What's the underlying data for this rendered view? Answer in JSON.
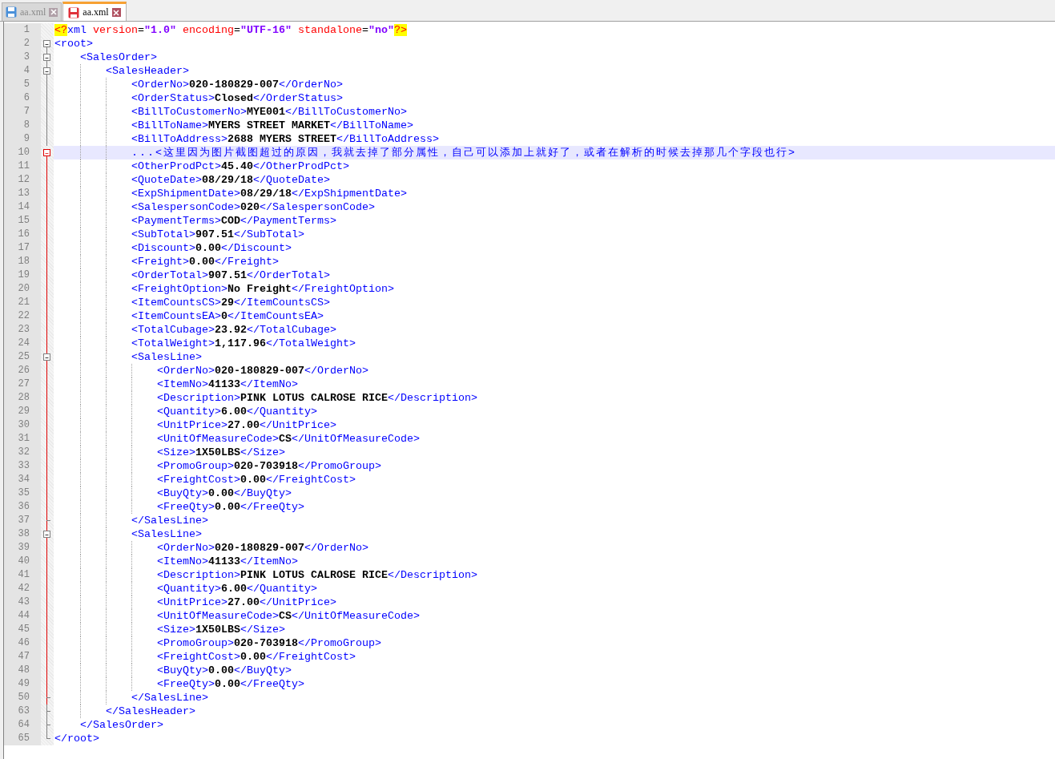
{
  "tabs": [
    {
      "label": "aa.xml",
      "selected": false,
      "modified": false
    },
    {
      "label": "aa.xml",
      "selected": true,
      "modified": true
    }
  ],
  "lines": [
    {
      "number": "1",
      "kind": "blank",
      "tokens": [
        {
          "kind": "pi",
          "text": "<?"
        },
        {
          "kind": "name",
          "text": "xml "
        },
        {
          "kind": "attr",
          "text": "version"
        },
        {
          "kind": "eq",
          "text": "="
        },
        {
          "kind": "value",
          "text": "\"1.0\""
        },
        {
          "kind": "attr",
          "text": " encoding"
        },
        {
          "kind": "eq",
          "text": "="
        },
        {
          "kind": "value",
          "text": "\"UTF-16\""
        },
        {
          "kind": "attr",
          "text": " standalone"
        },
        {
          "kind": "eq",
          "text": "="
        },
        {
          "kind": "value",
          "text": "\"no\""
        },
        {
          "kind": "pi",
          "text": "?>"
        }
      ]
    },
    {
      "number": "2",
      "kind": "root",
      "tokens": [
        {
          "kind": "tag",
          "text": "<root>"
        }
      ],
      "children": [
        {
          "number": "3",
          "kind": "open",
          "tokens": [
            {
              "kind": "tag",
              "text": "<SalesOrder>"
            }
          ],
          "children": [
            {
              "number": "4",
              "kind": "open",
              "tokens": [
                {
                  "kind": "tag",
                  "text": "<SalesHeader>"
                }
              ],
              "children": [
                {
                  "number": "5",
                  "kind": "line",
                  "tokens": [
                    {
                      "kind": "tag",
                      "text": "<OrderNo>"
                    },
                    {
                      "kind": "text",
                      "text": "020-180829-007"
                    },
                    {
                      "kind": "tag",
                      "text": "</OrderNo>"
                    }
                  ]
                },
                {
                  "number": "6",
                  "kind": "line",
                  "tokens": [
                    {
                      "kind": "tag",
                      "text": "<OrderStatus>"
                    },
                    {
                      "kind": "text",
                      "text": "Closed"
                    },
                    {
                      "kind": "tag",
                      "text": "</OrderStatus>"
                    }
                  ]
                },
                {
                  "number": "7",
                  "kind": "line",
                  "tokens": [
                    {
                      "kind": "tag",
                      "text": "<BillToCustomerNo>"
                    },
                    {
                      "kind": "text",
                      "text": "MYE001"
                    },
                    {
                      "kind": "tag",
                      "text": "</BillToCustomerNo>"
                    }
                  ]
                },
                {
                  "number": "8",
                  "kind": "line",
                  "tokens": [
                    {
                      "kind": "tag",
                      "text": "<BillToName>"
                    },
                    {
                      "kind": "text",
                      "text": "MYERS STREET MARKET"
                    },
                    {
                      "kind": "tag",
                      "text": "</BillToName>"
                    }
                  ]
                },
                {
                  "number": "9",
                  "kind": "line",
                  "tokens": [
                    {
                      "kind": "tag",
                      "text": "<BillToAddress>"
                    },
                    {
                      "kind": "text",
                      "text": "2688 MYERS STREET"
                    },
                    {
                      "kind": "tag",
                      "text": "</BillToAddress>"
                    }
                  ]
                },
                {
                  "number": "10",
                  "kind": "folded",
                  "current": true,
                  "red": true,
                  "tokens": [
                    {
                      "kind": "note",
                      "text": "...<这里因为图片截图超过的原因，我就去掉了部分属性，自己可以添加上就好了，或者在解析的时候去掉那几个字段也行>"
                    }
                  ]
                },
                {
                  "number": "11",
                  "kind": "line",
                  "red": true,
                  "tokens": [
                    {
                      "kind": "tag",
                      "text": "<OtherProdPct>"
                    },
                    {
                      "kind": "text",
                      "text": "45.40"
                    },
                    {
                      "kind": "tag",
                      "text": "</OtherProdPct>"
                    }
                  ]
                },
                {
                  "number": "12",
                  "kind": "line",
                  "red": true,
                  "tokens": [
                    {
                      "kind": "tag",
                      "text": "<QuoteDate>"
                    },
                    {
                      "kind": "text",
                      "text": "08/29/18"
                    },
                    {
                      "kind": "tag",
                      "text": "</QuoteDate>"
                    }
                  ]
                },
                {
                  "number": "13",
                  "kind": "line",
                  "red": true,
                  "tokens": [
                    {
                      "kind": "tag",
                      "text": "<ExpShipmentDate>"
                    },
                    {
                      "kind": "text",
                      "text": "08/29/18"
                    },
                    {
                      "kind": "tag",
                      "text": "</ExpShipmentDate>"
                    }
                  ]
                },
                {
                  "number": "14",
                  "kind": "line",
                  "red": true,
                  "tokens": [
                    {
                      "kind": "tag",
                      "text": "<SalespersonCode>"
                    },
                    {
                      "kind": "text",
                      "text": "020"
                    },
                    {
                      "kind": "tag",
                      "text": "</SalespersonCode>"
                    }
                  ]
                },
                {
                  "number": "15",
                  "kind": "line",
                  "red": true,
                  "tokens": [
                    {
                      "kind": "tag",
                      "text": "<PaymentTerms>"
                    },
                    {
                      "kind": "text",
                      "text": "COD"
                    },
                    {
                      "kind": "tag",
                      "text": "</PaymentTerms>"
                    }
                  ]
                },
                {
                  "number": "16",
                  "kind": "line",
                  "red": true,
                  "tokens": [
                    {
                      "kind": "tag",
                      "text": "<SubTotal>"
                    },
                    {
                      "kind": "text",
                      "text": "907.51"
                    },
                    {
                      "kind": "tag",
                      "text": "</SubTotal>"
                    }
                  ]
                },
                {
                  "number": "17",
                  "kind": "line",
                  "red": true,
                  "tokens": [
                    {
                      "kind": "tag",
                      "text": "<Discount>"
                    },
                    {
                      "kind": "text",
                      "text": "0.00"
                    },
                    {
                      "kind": "tag",
                      "text": "</Discount>"
                    }
                  ]
                },
                {
                  "number": "18",
                  "kind": "line",
                  "red": true,
                  "tokens": [
                    {
                      "kind": "tag",
                      "text": "<Freight>"
                    },
                    {
                      "kind": "text",
                      "text": "0.00"
                    },
                    {
                      "kind": "tag",
                      "text": "</Freight>"
                    }
                  ]
                },
                {
                  "number": "19",
                  "kind": "line",
                  "red": true,
                  "tokens": [
                    {
                      "kind": "tag",
                      "text": "<OrderTotal>"
                    },
                    {
                      "kind": "text",
                      "text": "907.51"
                    },
                    {
                      "kind": "tag",
                      "text": "</OrderTotal>"
                    }
                  ]
                },
                {
                  "number": "20",
                  "kind": "line",
                  "red": true,
                  "tokens": [
                    {
                      "kind": "tag",
                      "text": "<FreightOption>"
                    },
                    {
                      "kind": "text",
                      "text": "No Freight"
                    },
                    {
                      "kind": "tag",
                      "text": "</FreightOption>"
                    }
                  ]
                },
                {
                  "number": "21",
                  "kind": "line",
                  "red": true,
                  "tokens": [
                    {
                      "kind": "tag",
                      "text": "<ItemCountsCS>"
                    },
                    {
                      "kind": "text",
                      "text": "29"
                    },
                    {
                      "kind": "tag",
                      "text": "</ItemCountsCS>"
                    }
                  ]
                },
                {
                  "number": "22",
                  "kind": "line",
                  "red": true,
                  "tokens": [
                    {
                      "kind": "tag",
                      "text": "<ItemCountsEA>"
                    },
                    {
                      "kind": "text",
                      "text": "0"
                    },
                    {
                      "kind": "tag",
                      "text": "</ItemCountsEA>"
                    }
                  ]
                },
                {
                  "number": "23",
                  "kind": "line",
                  "red": true,
                  "tokens": [
                    {
                      "kind": "tag",
                      "text": "<TotalCubage>"
                    },
                    {
                      "kind": "text",
                      "text": "23.92"
                    },
                    {
                      "kind": "tag",
                      "text": "</TotalCubage>"
                    }
                  ]
                },
                {
                  "number": "24",
                  "kind": "line",
                  "red": true,
                  "tokens": [
                    {
                      "kind": "tag",
                      "text": "<TotalWeight>"
                    },
                    {
                      "kind": "text",
                      "text": "1,117.96"
                    },
                    {
                      "kind": "tag",
                      "text": "</TotalWeight>"
                    }
                  ]
                },
                {
                  "number": "25",
                  "kind": "open",
                  "red": true,
                  "tokens": [
                    {
                      "kind": "tag",
                      "text": "<SalesLine>"
                    }
                  ],
                  "children": [
                    {
                      "number": "26",
                      "kind": "line",
                      "red": true,
                      "tokens": [
                        {
                          "kind": "tag",
                          "text": "<OrderNo>"
                        },
                        {
                          "kind": "text",
                          "text": "020-180829-007"
                        },
                        {
                          "kind": "tag",
                          "text": "</OrderNo>"
                        }
                      ]
                    },
                    {
                      "number": "27",
                      "kind": "line",
                      "red": true,
                      "tokens": [
                        {
                          "kind": "tag",
                          "text": "<ItemNo>"
                        },
                        {
                          "kind": "text",
                          "text": "41133"
                        },
                        {
                          "kind": "tag",
                          "text": "</ItemNo>"
                        }
                      ]
                    },
                    {
                      "number": "28",
                      "kind": "line",
                      "red": true,
                      "tokens": [
                        {
                          "kind": "tag",
                          "text": "<Description>"
                        },
                        {
                          "kind": "text",
                          "text": "PINK LOTUS CALROSE RICE"
                        },
                        {
                          "kind": "tag",
                          "text": "</Description>"
                        }
                      ]
                    },
                    {
                      "number": "29",
                      "kind": "line",
                      "red": true,
                      "tokens": [
                        {
                          "kind": "tag",
                          "text": "<Quantity>"
                        },
                        {
                          "kind": "text",
                          "text": "6.00"
                        },
                        {
                          "kind": "tag",
                          "text": "</Quantity>"
                        }
                      ]
                    },
                    {
                      "number": "30",
                      "kind": "line",
                      "red": true,
                      "tokens": [
                        {
                          "kind": "tag",
                          "text": "<UnitPrice>"
                        },
                        {
                          "kind": "text",
                          "text": "27.00"
                        },
                        {
                          "kind": "tag",
                          "text": "</UnitPrice>"
                        }
                      ]
                    },
                    {
                      "number": "31",
                      "kind": "line",
                      "red": true,
                      "tokens": [
                        {
                          "kind": "tag",
                          "text": "<UnitOfMeasureCode>"
                        },
                        {
                          "kind": "text",
                          "text": "CS"
                        },
                        {
                          "kind": "tag",
                          "text": "</UnitOfMeasureCode>"
                        }
                      ]
                    },
                    {
                      "number": "32",
                      "kind": "line",
                      "red": true,
                      "tokens": [
                        {
                          "kind": "tag",
                          "text": "<Size>"
                        },
                        {
                          "kind": "text",
                          "text": "1X50LBS"
                        },
                        {
                          "kind": "tag",
                          "text": "</Size>"
                        }
                      ]
                    },
                    {
                      "number": "33",
                      "kind": "line",
                      "red": true,
                      "tokens": [
                        {
                          "kind": "tag",
                          "text": "<PromoGroup>"
                        },
                        {
                          "kind": "text",
                          "text": "020-703918"
                        },
                        {
                          "kind": "tag",
                          "text": "</PromoGroup>"
                        }
                      ]
                    },
                    {
                      "number": "34",
                      "kind": "line",
                      "red": true,
                      "tokens": [
                        {
                          "kind": "tag",
                          "text": "<FreightCost>"
                        },
                        {
                          "kind": "text",
                          "text": "0.00"
                        },
                        {
                          "kind": "tag",
                          "text": "</FreightCost>"
                        }
                      ]
                    },
                    {
                      "number": "35",
                      "kind": "line",
                      "red": true,
                      "tokens": [
                        {
                          "kind": "tag",
                          "text": "<BuyQty>"
                        },
                        {
                          "kind": "text",
                          "text": "0.00"
                        },
                        {
                          "kind": "tag",
                          "text": "</BuyQty>"
                        }
                      ]
                    },
                    {
                      "number": "36",
                      "kind": "line",
                      "red": true,
                      "tokens": [
                        {
                          "kind": "tag",
                          "text": "<FreeQty>"
                        },
                        {
                          "kind": "text",
                          "text": "0.00"
                        },
                        {
                          "kind": "tag",
                          "text": "</FreeQty>"
                        }
                      ]
                    }
                  ]
                },
                {
                  "number": "37",
                  "kind": "end",
                  "red": true,
                  "tokens": [
                    {
                      "kind": "tag",
                      "text": "</SalesLine>"
                    }
                  ]
                },
                {
                  "number": "38",
                  "kind": "open",
                  "red": true,
                  "tokens": [
                    {
                      "kind": "tag",
                      "text": "<SalesLine>"
                    }
                  ],
                  "children": [
                    {
                      "number": "39",
                      "kind": "line",
                      "red": true,
                      "tokens": [
                        {
                          "kind": "tag",
                          "text": "<OrderNo>"
                        },
                        {
                          "kind": "text",
                          "text": "020-180829-007"
                        },
                        {
                          "kind": "tag",
                          "text": "</OrderNo>"
                        }
                      ]
                    },
                    {
                      "number": "40",
                      "kind": "line",
                      "red": true,
                      "tokens": [
                        {
                          "kind": "tag",
                          "text": "<ItemNo>"
                        },
                        {
                          "kind": "text",
                          "text": "41133"
                        },
                        {
                          "kind": "tag",
                          "text": "</ItemNo>"
                        }
                      ]
                    },
                    {
                      "number": "41",
                      "kind": "line",
                      "red": true,
                      "tokens": [
                        {
                          "kind": "tag",
                          "text": "<Description>"
                        },
                        {
                          "kind": "text",
                          "text": "PINK LOTUS CALROSE RICE"
                        },
                        {
                          "kind": "tag",
                          "text": "</Description>"
                        }
                      ]
                    },
                    {
                      "number": "42",
                      "kind": "line",
                      "red": true,
                      "tokens": [
                        {
                          "kind": "tag",
                          "text": "<Quantity>"
                        },
                        {
                          "kind": "text",
                          "text": "6.00"
                        },
                        {
                          "kind": "tag",
                          "text": "</Quantity>"
                        }
                      ]
                    },
                    {
                      "number": "43",
                      "kind": "line",
                      "red": true,
                      "tokens": [
                        {
                          "kind": "tag",
                          "text": "<UnitPrice>"
                        },
                        {
                          "kind": "text",
                          "text": "27.00"
                        },
                        {
                          "kind": "tag",
                          "text": "</UnitPrice>"
                        }
                      ]
                    },
                    {
                      "number": "44",
                      "kind": "line",
                      "red": true,
                      "tokens": [
                        {
                          "kind": "tag",
                          "text": "<UnitOfMeasureCode>"
                        },
                        {
                          "kind": "text",
                          "text": "CS"
                        },
                        {
                          "kind": "tag",
                          "text": "</UnitOfMeasureCode>"
                        }
                      ]
                    },
                    {
                      "number": "45",
                      "kind": "line",
                      "red": true,
                      "tokens": [
                        {
                          "kind": "tag",
                          "text": "<Size>"
                        },
                        {
                          "kind": "text",
                          "text": "1X50LBS"
                        },
                        {
                          "kind": "tag",
                          "text": "</Size>"
                        }
                      ]
                    },
                    {
                      "number": "46",
                      "kind": "line",
                      "red": true,
                      "tokens": [
                        {
                          "kind": "tag",
                          "text": "<PromoGroup>"
                        },
                        {
                          "kind": "text",
                          "text": "020-703918"
                        },
                        {
                          "kind": "tag",
                          "text": "</PromoGroup>"
                        }
                      ]
                    },
                    {
                      "number": "47",
                      "kind": "line",
                      "red": true,
                      "tokens": [
                        {
                          "kind": "tag",
                          "text": "<FreightCost>"
                        },
                        {
                          "kind": "text",
                          "text": "0.00"
                        },
                        {
                          "kind": "tag",
                          "text": "</FreightCost>"
                        }
                      ]
                    },
                    {
                      "number": "48",
                      "kind": "line",
                      "red": true,
                      "tokens": [
                        {
                          "kind": "tag",
                          "text": "<BuyQty>"
                        },
                        {
                          "kind": "text",
                          "text": "0.00"
                        },
                        {
                          "kind": "tag",
                          "text": "</BuyQty>"
                        }
                      ]
                    },
                    {
                      "number": "49",
                      "kind": "line",
                      "red": true,
                      "tokens": [
                        {
                          "kind": "tag",
                          "text": "<FreeQty>"
                        },
                        {
                          "kind": "text",
                          "text": "0.00"
                        },
                        {
                          "kind": "tag",
                          "text": "</FreeQty>"
                        }
                      ]
                    }
                  ]
                },
                {
                  "number": "50",
                  "kind": "end",
                  "red": true,
                  "tokens": [
                    {
                      "kind": "tag",
                      "text": "</SalesLine>"
                    }
                  ]
                }
              ]
            },
            {
              "number": "63",
              "kind": "end",
              "tokens": [
                {
                  "kind": "tag",
                  "text": "</SalesHeader>"
                }
              ]
            }
          ]
        },
        {
          "number": "64",
          "kind": "end",
          "tokens": [
            {
              "kind": "tag",
              "text": "</SalesOrder>"
            }
          ]
        }
      ]
    },
    {
      "number": "65",
      "kind": "last",
      "tokens": [
        {
          "kind": "tag",
          "text": "</root>"
        }
      ]
    }
  ]
}
